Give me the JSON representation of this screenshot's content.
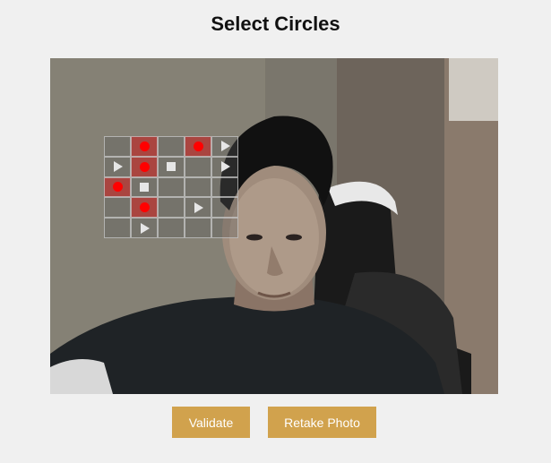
{
  "title": "Select Circles",
  "photo": {
    "description_icon": "webcam-photo",
    "grid": {
      "rows": 5,
      "cols": 5,
      "cells": [
        [
          "",
          "circle-selected",
          "",
          "circle-selected",
          "triangle"
        ],
        [
          "triangle",
          "circle-selected",
          "square",
          "",
          "triangle"
        ],
        [
          "circle-selected",
          "square",
          "",
          "",
          ""
        ],
        [
          "",
          "circle-selected",
          "",
          "triangle",
          ""
        ],
        [
          "",
          "triangle",
          "",
          "",
          ""
        ]
      ]
    }
  },
  "buttons": {
    "validate_label": "Validate",
    "retake_label": "Retake Photo"
  },
  "colors": {
    "accent": "#d1a24d",
    "selected_cell": "#c81414",
    "circle": "#ff0000"
  }
}
